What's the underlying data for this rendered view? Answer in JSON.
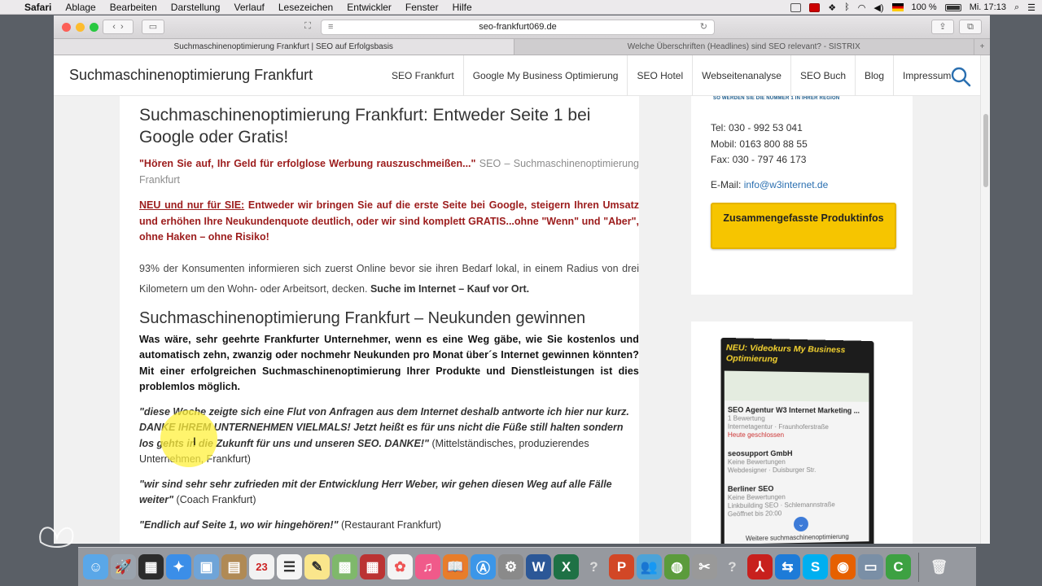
{
  "menubar": {
    "app": "Safari",
    "items": [
      "Ablage",
      "Bearbeiten",
      "Darstellung",
      "Verlauf",
      "Lesezeichen",
      "Entwickler",
      "Fenster",
      "Hilfe"
    ],
    "battery": "100 %",
    "clock": "Mi. 17:13"
  },
  "browser": {
    "url": "seo-frankfurt069.de",
    "tabs": [
      "Suchmaschinenoptimierung Frankfurt | SEO auf Erfolgsbasis",
      "Welche Überschriften (Headlines) sind SEO relevant? - SISTRIX"
    ]
  },
  "site": {
    "brand": "Suchmaschinenoptimierung Frankfurt",
    "nav": [
      "SEO Frankfurt",
      "Google My Business Optimierung",
      "SEO Hotel",
      "Webseitenanalyse",
      "SEO Buch",
      "Blog",
      "Impressum"
    ]
  },
  "article": {
    "h1": "Suchmaschinenoptimierung Frankfurt: Entweder Seite 1 bei Google oder Gratis!",
    "intro_red": "\"Hören Sie auf, Ihr Geld für erfolglose Werbung rauszuschmeißen...\"",
    "intro_grey": "SEO – Suchmaschinenoptimierung Frankfurt",
    "offer_label": "NEU und nur für SIE:",
    "offer_text": "Entweder wir bringen Sie auf die erste Seite bei Google, steigern Ihren Umsatz und erhöhen Ihre Neukundenquote deutlich, oder wir sind komplett GRATIS...ohne \"Wenn\" und \"Aber\", ohne Haken – ohne Risiko!",
    "stat_text": "93% der Konsumenten informieren sich zuerst Online bevor sie ihren Bedarf lokal, in einem Radius von drei Kilometern um den Wohn- oder Arbeitsort, decken.",
    "stat_bold": "Suche im Internet – Kauf vor Ort.",
    "h2": "Suchmaschinenoptimierung Frankfurt – Neukunden gewinnen",
    "lead": "Was wäre, sehr geehrte Frankfurter Unternehmer, wenn es eine Weg gäbe, wie Sie kostenlos und automatisch zehn, zwanzig oder nochmehr Neukunden pro Monat über´s Internet gewinnen könnten? Mit einer erfolgreichen Suchmaschinenoptimierung Ihrer Produkte und Dienstleistungen ist dies problemlos möglich.",
    "quotes": [
      {
        "text": "\"diese Woche zeigte sich eine Flut von Anfragen aus dem Internet deshalb antworte ich hier nur kurz. DANKE IHREM UNTERNEHMEN VIELMALS! Jetzt heißt es für uns nicht die Füße still halten sondern los gehts in die Zukunft für uns und unseren SEO. DANKE!\"",
        "source": "(Mittelständisches, produzierendes Unternehmen, Frankfurt)"
      },
      {
        "text": "\"wir sind sehr sehr zufrieden mit der Entwicklung Herr Weber, wir gehen diesen Weg auf alle Fälle weiter\"",
        "source": "(Coach Frankfurt)"
      },
      {
        "text": "\"Endlich auf Seite 1, wo wir hingehören!\"",
        "source": "(Restaurant Frankfurt)"
      }
    ]
  },
  "sidebar": {
    "logo_tagline": "SO WERDEN SIE DIE NUMMER 1 IN IHRER REGION",
    "tel": "Tel: 030 - 992 53 041",
    "mobil": "Mobil: 0163 800 88 55",
    "fax": "Fax: 030 - 797 46 173",
    "email_label": "E-Mail:",
    "email": "info@w3internet.de",
    "cta": "Zusammengefasste Produktinfos",
    "dvd_title": "NEU: Videokurs My Business Optimierung",
    "dvd_items": [
      {
        "name": "SEO Agentur W3 Internet Marketing ...",
        "sub": "1 Bewertung",
        "extra": "Internetagentur · Fraunhoferstraße",
        "note": "Heute geschlossen"
      },
      {
        "name": "seosupport GmbH",
        "sub": "Keine Bewertungen",
        "extra": "Webdesigner · Duisburger Str.",
        "note": ""
      },
      {
        "name": "Berliner SEO",
        "sub": "Keine Bewertungen",
        "extra": "Linkbuilding SEO · Schlemannstraße",
        "note": "Geöffnet bis 20:00"
      }
    ],
    "dvd_more": "Weitere suchmaschinenoptimierung"
  },
  "colors": {
    "accent_red": "#9c1c1c",
    "cta_yellow": "#f6c500",
    "link_blue": "#2a6fb0"
  }
}
